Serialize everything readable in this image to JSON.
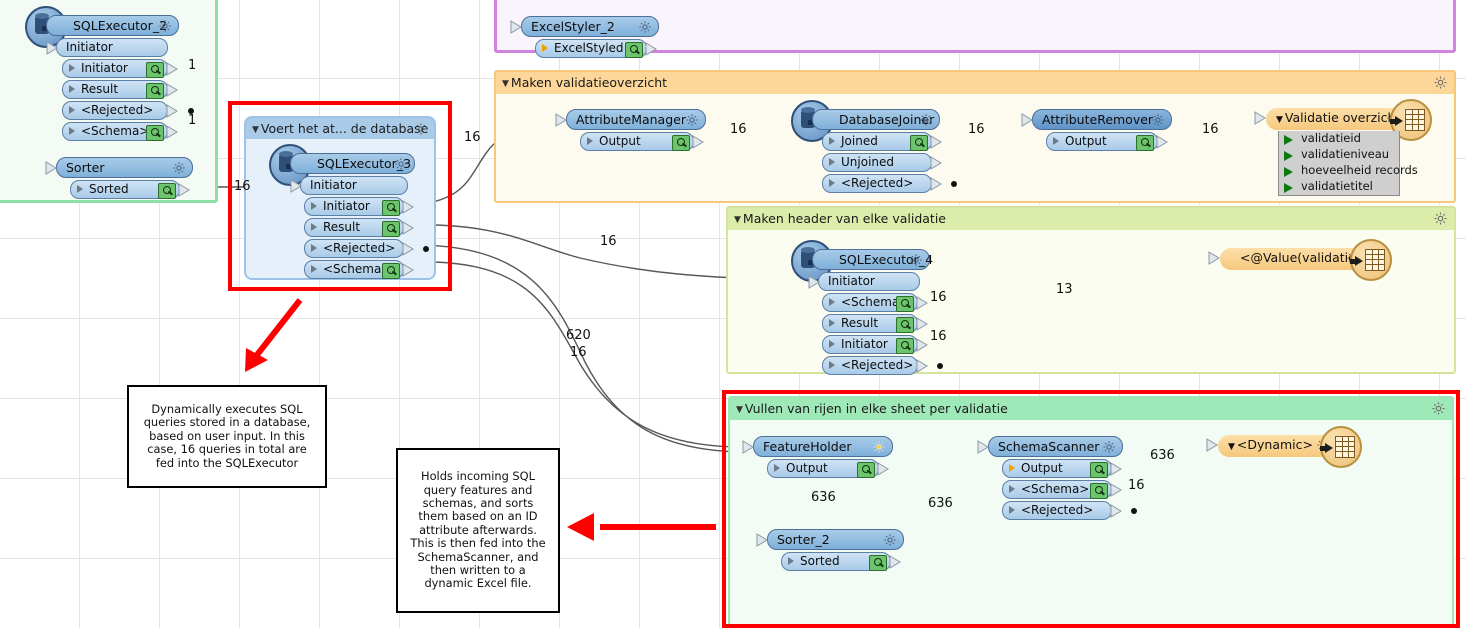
{
  "groups": [
    {
      "id": "green_left",
      "title": ""
    },
    {
      "id": "purple_top",
      "title": ""
    },
    {
      "id": "orange",
      "title": "Maken validatieoverzicht"
    },
    {
      "id": "lime",
      "title": "Maken header van elke validatie"
    },
    {
      "id": "mint",
      "title": "Vullen van rijen in elke sheet per validatie"
    },
    {
      "id": "blue_inner",
      "title": "Voert het at... de database"
    }
  ],
  "nodes": {
    "sqlexecutor_2": {
      "title": "SQLExecutor_2",
      "input": "Initiator",
      "ports": [
        "Initiator",
        "Result",
        "<Rejected>",
        "<Schema>"
      ]
    },
    "sorter": {
      "title": "Sorter",
      "ports": [
        "Sorted"
      ]
    },
    "sqlexecutor_3": {
      "title": "SQLExecutor_3",
      "input": "Initiator",
      "ports": [
        "Initiator",
        "Result",
        "<Rejected>",
        "<Schema>"
      ]
    },
    "excelstyler_2": {
      "title": "ExcelStyler_2",
      "ports": [
        "ExcelStyled"
      ]
    },
    "attributemanager": {
      "title": "AttributeManager",
      "ports": [
        "Output"
      ]
    },
    "databasejoiner": {
      "title": "DatabaseJoiner",
      "ports": [
        "Joined",
        "Unjoined",
        "<Rejected>"
      ]
    },
    "attributeremover": {
      "title": "AttributeRemover",
      "ports": [
        "Output"
      ]
    },
    "validatie_overzicht": {
      "title": "Validatie overzicht",
      "attributes": [
        "validatieid",
        "validatieniveau",
        "hoeveelheid records",
        "validatietitel"
      ]
    },
    "sqlexecutor_4": {
      "title": "SQLExecutor_4",
      "input": "Initiator",
      "ports": [
        "<Schema>",
        "Result",
        "Initiator",
        "<Rejected>"
      ]
    },
    "value_validatieid": {
      "title": "<@Value(validatieid)>"
    },
    "featureholder": {
      "title": "FeatureHolder",
      "ports": [
        "Output"
      ]
    },
    "sorter_2": {
      "title": "Sorter_2",
      "ports": [
        "Sorted"
      ]
    },
    "schemascanner": {
      "title": "SchemaScanner",
      "ports": [
        "Output",
        "<Schema>",
        "<Rejected>"
      ]
    },
    "dynamic_writer": {
      "title": "<Dynamic>"
    }
  },
  "connection_labels": [
    {
      "id": "l1",
      "value": "1"
    },
    {
      "id": "l2",
      "value": "1"
    },
    {
      "id": "l3",
      "value": "16"
    },
    {
      "id": "l4",
      "value": "16"
    },
    {
      "id": "l5",
      "value": "16"
    },
    {
      "id": "l6",
      "value": "16"
    },
    {
      "id": "l7",
      "value": "16"
    },
    {
      "id": "l8",
      "value": "16"
    },
    {
      "id": "l9",
      "value": "13"
    },
    {
      "id": "l10",
      "value": "16"
    },
    {
      "id": "l11",
      "value": "16"
    },
    {
      "id": "l12",
      "value": "620"
    },
    {
      "id": "l13",
      "value": "16"
    },
    {
      "id": "l14",
      "value": "636"
    },
    {
      "id": "l15",
      "value": "636"
    },
    {
      "id": "l16",
      "value": "636"
    },
    {
      "id": "l17",
      "value": "16"
    }
  ],
  "notes": {
    "note_sqlexecutor": "Dynamically executes SQL queries stored in a database, based on user input. In this case, 16 queries in total are fed into the SQLExecutor",
    "note_featureholder": "Holds incoming SQL query features and schemas, and sorts them based on an ID attribute afterwards. This is then fed into the SchemaScanner, and then written to a dynamic Excel file."
  },
  "colors": {
    "highlight_red": "#ff0000",
    "group_green": "#8fe0a4",
    "group_purple": "#d183e0",
    "group_orange": "#fdd79a",
    "group_lime": "#dcecab",
    "group_mint": "#9fe8b8",
    "node_blue": "#a8cbe8",
    "writer_orange": "#f6c87d",
    "magnifier_green": "#6cc46c"
  }
}
